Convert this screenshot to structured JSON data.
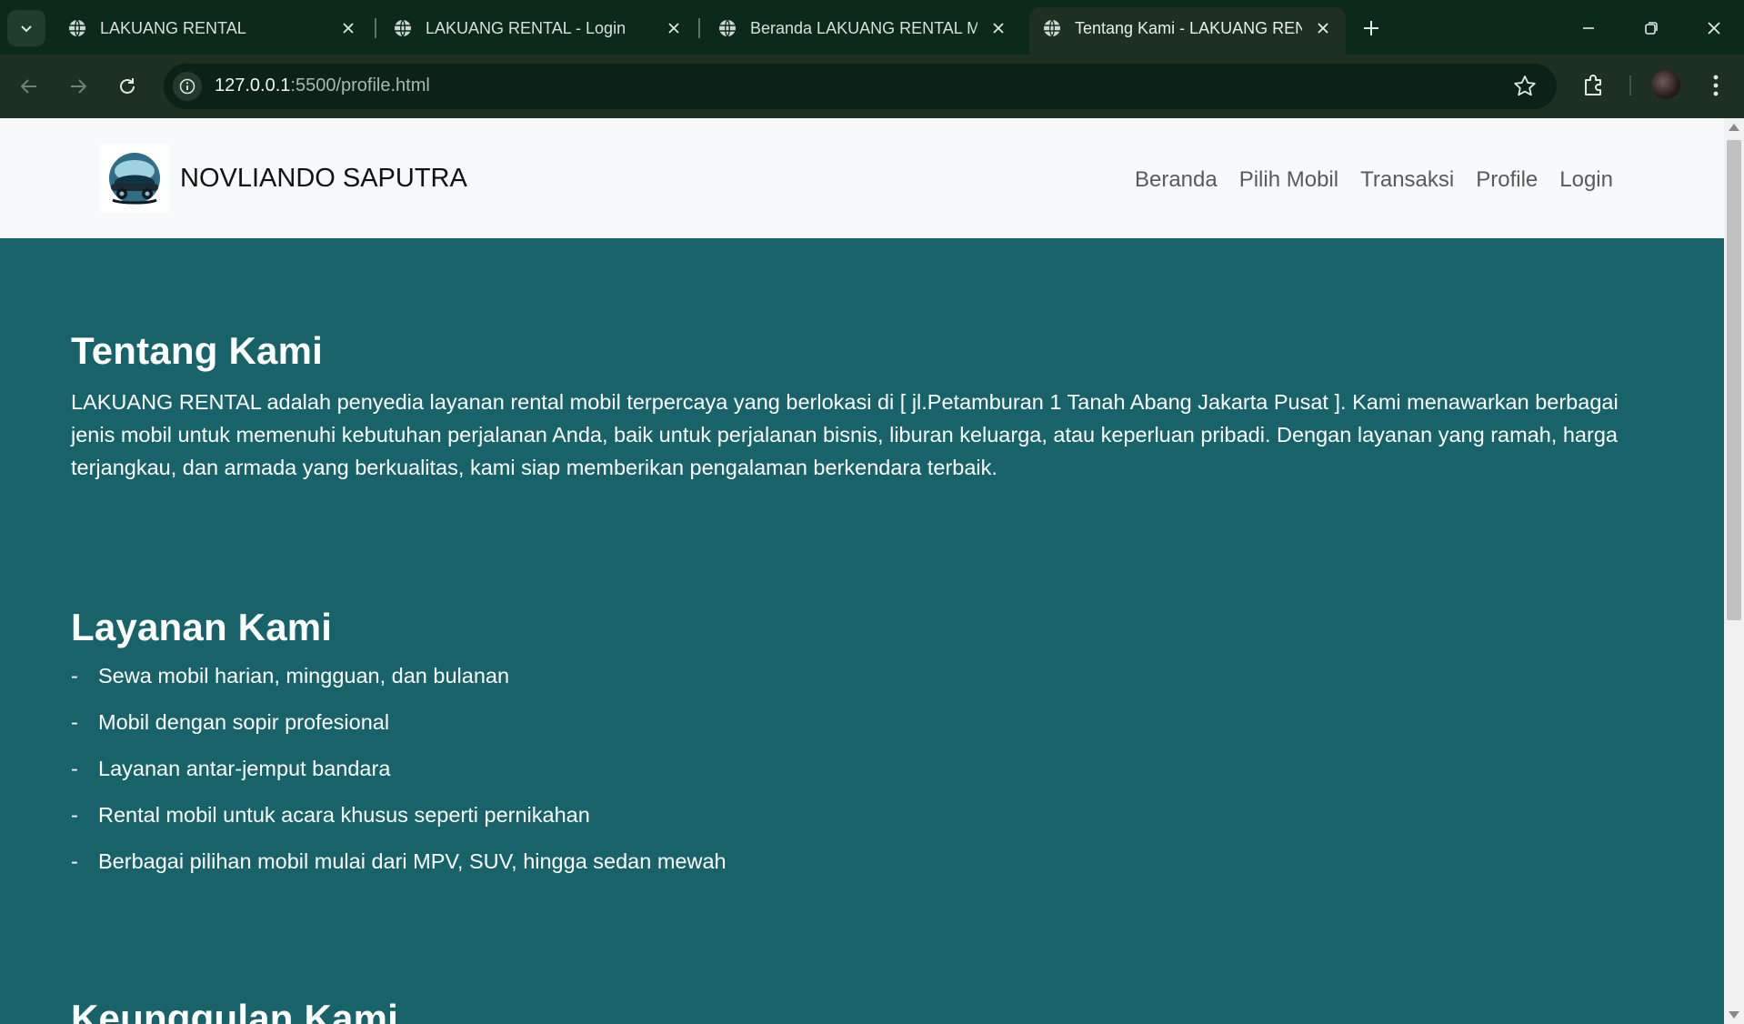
{
  "browser": {
    "tabs": [
      {
        "title": "LAKUANG RENTAL",
        "active": false
      },
      {
        "title": "LAKUANG RENTAL - Login",
        "active": false
      },
      {
        "title": "Beranda LAKUANG RENTAL Mo",
        "active": false
      },
      {
        "title": "Tentang Kami - LAKUANG RENT",
        "active": true
      }
    ],
    "url_host": "127.0.0.1",
    "url_rest": ":5500/profile.html"
  },
  "site": {
    "brand": "NOVLIANDO SAPUTRA",
    "nav": [
      "Beranda",
      "Pilih Mobil",
      "Transaksi",
      "Profile",
      "Login"
    ]
  },
  "about": {
    "title": "Tentang Kami",
    "text": "LAKUANG RENTAL adalah penyedia layanan rental mobil terpercaya yang berlokasi di [ jl.Petamburan 1 Tanah Abang Jakarta Pusat ]. Kami menawarkan berbagai jenis mobil untuk memenuhi kebutuhan perjalanan Anda, baik untuk perjalanan bisnis, liburan keluarga, atau keperluan pribadi. Dengan layanan yang ramah, harga terjangkau, dan armada yang berkualitas, kami siap memberikan pengalaman berkendara terbaik."
  },
  "services": {
    "title": "Layanan Kami",
    "bullet": "-",
    "items": [
      "Sewa mobil harian, mingguan, dan bulanan",
      "Mobil dengan sopir profesional",
      "Layanan antar-jemput bandara",
      "Rental mobil untuk acara khusus seperti pernikahan",
      "Berbagai pilihan mobil mulai dari MPV, SUV, hingga sedan mewah"
    ]
  },
  "advantages": {
    "title": "Keunggulan Kami"
  },
  "colors": {
    "page_bg": "#186369",
    "navbar_bg": "#f8f9fa",
    "chrome_dark": "#0b2a19",
    "toolbar": "#1d3022"
  }
}
